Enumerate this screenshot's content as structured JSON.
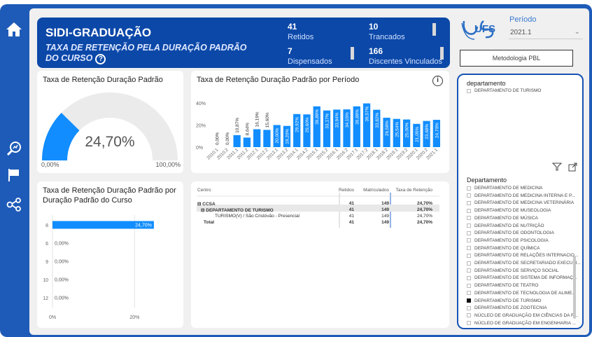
{
  "header": {
    "title": "SIDI-GRADUAÇÃO",
    "subtitle": "TAXA DE RETENÇÃO PELA DURAÇÃO PADRÃO DO CURSO",
    "help": "?"
  },
  "kpis": {
    "retidos": {
      "value": "41",
      "label": "Retidos"
    },
    "trancados": {
      "value": "10",
      "label": "Trancados"
    },
    "dispensados": {
      "value": "7",
      "label": "Dispensados"
    },
    "vinculados": {
      "value": "166",
      "label": "Discentes Vinculados"
    }
  },
  "logo": {
    "text": "UFS"
  },
  "periodo": {
    "label": "Período",
    "value": "2021.1"
  },
  "metodologia": {
    "label": "Metodologia PBL"
  },
  "gauge": {
    "title": "Taxa de Retenção Duração Padrão",
    "value_text": "24,70%",
    "value": 24.7,
    "min_label": "0,00%",
    "max_label": "100,00%",
    "color": "#118dff"
  },
  "period_chart": {
    "title": "Taxa de Retenção Duração Padrão por Período",
    "info": "i",
    "y_ticks": [
      "40%",
      "20%",
      "0%"
    ],
    "chart_data": {
      "type": "bar",
      "categories": [
        "2010.1",
        "2010.2",
        "2011.1",
        "2011.2",
        "2012.1",
        "2012.2",
        "2013.1",
        "2013.2",
        "2014.1",
        "2014.2",
        "2015.1",
        "2015.2",
        "2016.1",
        "2016.2",
        "2017.1",
        "2017.2",
        "2018.1",
        "2018.2",
        "2019.1",
        "2019.2",
        "2020.1",
        "2020.2",
        "2021.1"
      ],
      "values": [
        0.0,
        0.0,
        10.87,
        8.64,
        16.19,
        15.6,
        20.0,
        19.2,
        29.92,
        29.6,
        36.89,
        33.17,
        33.94,
        34.15,
        36.89,
        39.57,
        33.82,
        26.58,
        25.54,
        25.0,
        21.05,
        23.68,
        24.7
      ],
      "labels": [
        "0,00%",
        "0,00%",
        "10,87%",
        "8,64%",
        "16,19%",
        "15,60%",
        "20,00%",
        "19,20%",
        "29,92%",
        "29,60%",
        "36,89%",
        "33,17%",
        "33,94%",
        "34,15%",
        "36,89%",
        "39,57%",
        "33,82%",
        "26,58%",
        "25,54%",
        "25,00%",
        "21,05%",
        "23,68%",
        "24,70%"
      ],
      "ylim": [
        0,
        45
      ],
      "color": "#118dff"
    }
  },
  "duration_chart": {
    "title": "Taxa de Retenção Duração Padrão por Duração Padrão do Curso",
    "x_ticks": [
      "0%",
      "20%"
    ],
    "chart_data": {
      "type": "bar",
      "orientation": "horizontal",
      "categories": [
        "8",
        "6",
        "9",
        "10",
        "12"
      ],
      "values": [
        24.7,
        0.0,
        0.0,
        0.0,
        0.0
      ],
      "labels": [
        "24,70%",
        "0,00%",
        "0,00%",
        "0,00%",
        "0,00%"
      ],
      "xlim": [
        0,
        30
      ],
      "color": "#118dff"
    }
  },
  "table": {
    "headers": [
      "Centro",
      "Retidos",
      "Matriculados",
      "Taxa de Retenção"
    ],
    "rows": [
      {
        "expander": "⊟",
        "name": "CCSA",
        "retidos": "41",
        "matriculados": "149",
        "taxa": "24,70%"
      },
      {
        "expander": "⊟",
        "name": "DEPARTAMENTO DE TURISMO",
        "retidos": "41",
        "matriculados": "149",
        "taxa": "24,70%"
      },
      {
        "expander": "",
        "name": "TURISMO(V) / São Cristóvão - Presencial",
        "retidos": "41",
        "matriculados": "149",
        "taxa": "24,70%"
      },
      {
        "expander": "",
        "name": "Total",
        "retidos": "41",
        "matriculados": "149",
        "taxa": "24,70%"
      }
    ]
  },
  "filters": {
    "dept_top_label": "departamento",
    "dept_top_items": [
      "DEPARTAMENTO DE TURISMO"
    ],
    "dept_label": "Departamento",
    "dept_items": [
      {
        "label": "DEPARTAMENTO DE MEDICINA",
        "checked": false
      },
      {
        "label": "DEPARTAMENTO DE MEDICINA INTERNA E P...",
        "checked": false
      },
      {
        "label": "DEPARTAMENTO DE MEDICINA VETERINÁRIA",
        "checked": false
      },
      {
        "label": "DEPARTAMENTO DE MUSEOLOGIA",
        "checked": false
      },
      {
        "label": "DEPARTAMENTO DE MÚSICA",
        "checked": false
      },
      {
        "label": "DEPARTAMENTO DE NUTRIÇÃO",
        "checked": false
      },
      {
        "label": "DEPARTAMENTO DE ODONTOLOGIA",
        "checked": false
      },
      {
        "label": "DEPARTAMENTO DE PSICOLOGIA",
        "checked": false
      },
      {
        "label": "DEPARTAMENTO DE QUÍMICA",
        "checked": false
      },
      {
        "label": "DEPARTAMENTO DE RELAÇÕES INTERNACIO...",
        "checked": false
      },
      {
        "label": "DEPARTAMENTO DE SECRETARIADO EXECUTI...",
        "checked": false
      },
      {
        "label": "DEPARTAMENTO DE SERVIÇO SOCIAL",
        "checked": false
      },
      {
        "label": "DEPARTAMENTO DE SISTEMA DE INFORMAÇ...",
        "checked": false
      },
      {
        "label": "DEPARTAMENTO DE TEATRO",
        "checked": false
      },
      {
        "label": "DEPARTAMENTO DE TECNOLOGIA DE ALIME...",
        "checked": false
      },
      {
        "label": "DEPARTAMENTO DE TURISMO",
        "checked": true
      },
      {
        "label": "DEPARTAMENTO DE ZOOTECNIA",
        "checked": false
      },
      {
        "label": "NÚCLEO DE GRADUAÇÃO EM CIÊNCIAS DA R...",
        "checked": false
      },
      {
        "label": "NÚCLEO DE GRADUAÇÃO EM ENGENHARIA ...",
        "checked": false
      }
    ]
  },
  "sidebar": {
    "icons": [
      "home-icon",
      "search-chart-icon",
      "flag-icon",
      "share-nodes-icon"
    ]
  }
}
